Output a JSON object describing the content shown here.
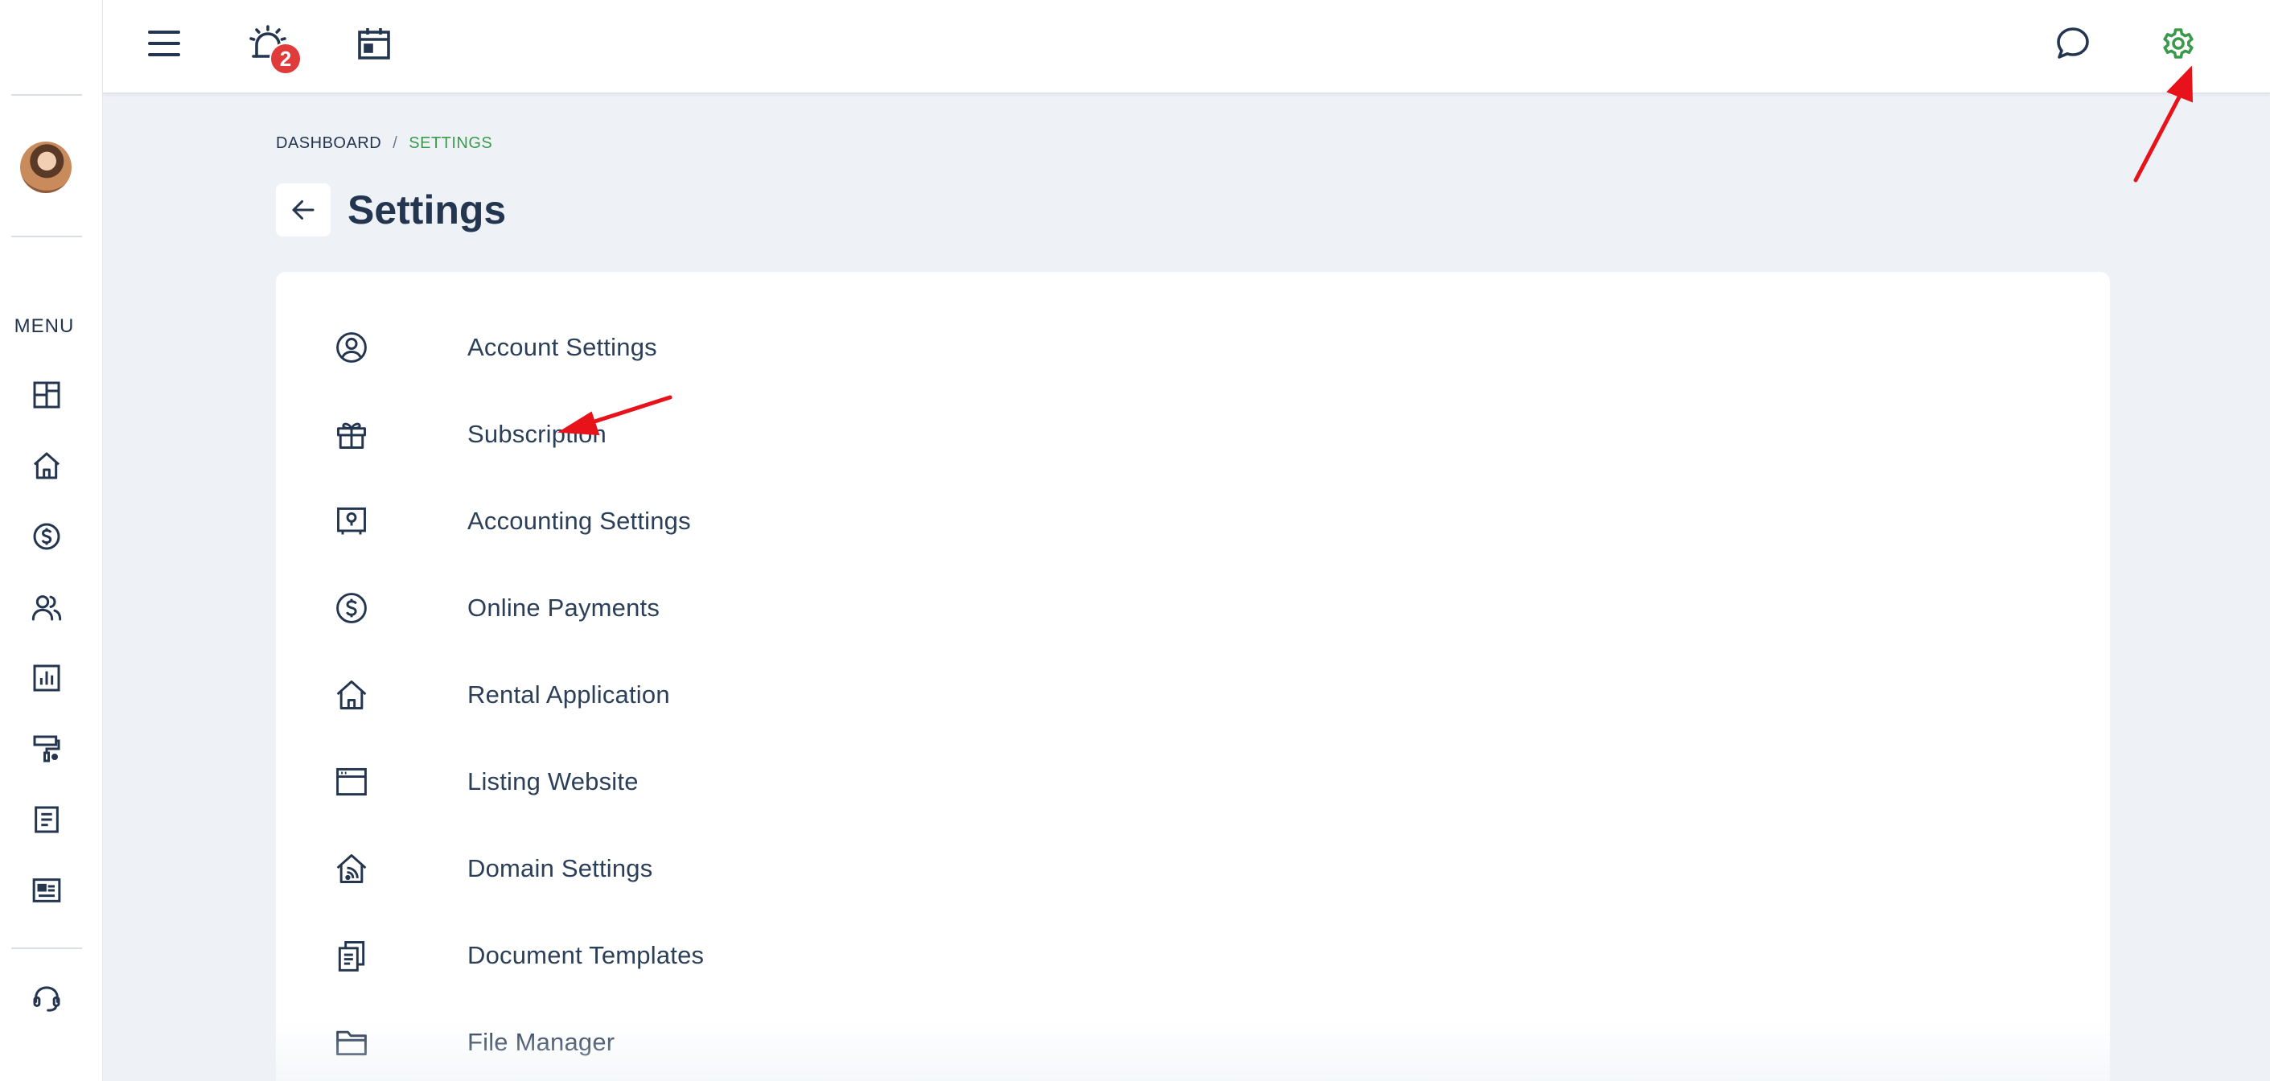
{
  "topbar": {
    "notification_count": "2",
    "icons": [
      "menu-icon",
      "alarm-icon",
      "calendar-icon",
      "chat-icon",
      "gear-icon"
    ],
    "active_color": "#3a9a4a"
  },
  "sidebar": {
    "menu_label": "MENU",
    "items": [
      {
        "icon": "dashboard-grid-icon"
      },
      {
        "icon": "home-icon"
      },
      {
        "icon": "dollar-circle-icon"
      },
      {
        "icon": "users-icon"
      },
      {
        "icon": "reports-chart-icon"
      },
      {
        "icon": "maintenance-roller-icon"
      },
      {
        "icon": "document-icon"
      },
      {
        "icon": "listing-card-icon"
      },
      {
        "icon": "support-headset-icon"
      }
    ]
  },
  "breadcrumb": {
    "root": "DASHBOARD",
    "separator": "/",
    "current": "SETTINGS"
  },
  "page": {
    "title": "Settings"
  },
  "settings": {
    "items": [
      {
        "label": "Account Settings",
        "icon": "user-circle-icon"
      },
      {
        "label": "Subscription",
        "icon": "gift-icon"
      },
      {
        "label": "Accounting Settings",
        "icon": "safe-icon"
      },
      {
        "label": "Online Payments",
        "icon": "dollar-circle-icon"
      },
      {
        "label": "Rental Application",
        "icon": "home-icon"
      },
      {
        "label": "Listing Website",
        "icon": "browser-window-icon"
      },
      {
        "label": "Domain Settings",
        "icon": "home-wifi-icon"
      },
      {
        "label": "Document Templates",
        "icon": "copy-document-icon"
      },
      {
        "label": "File Manager",
        "icon": "folder-icon"
      }
    ]
  },
  "colors": {
    "text": "#24364f",
    "accent_green": "#3a9a4a",
    "badge_red": "#e03a3a",
    "annotation_red": "#e8121b",
    "background": "#eef2f7"
  }
}
